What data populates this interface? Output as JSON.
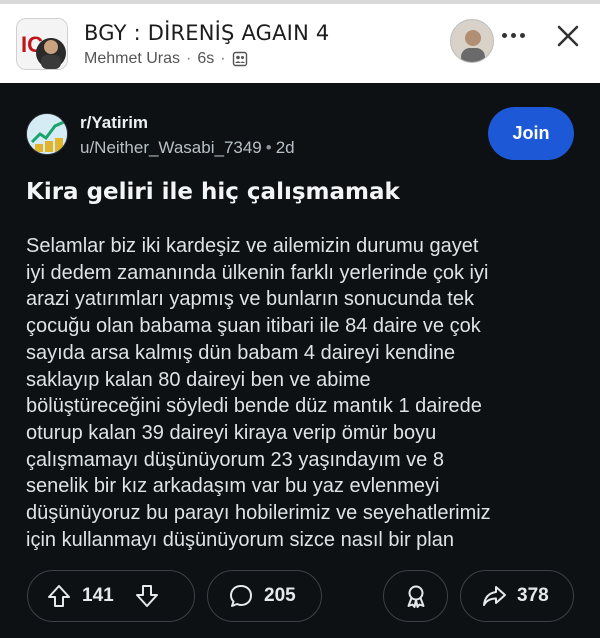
{
  "header": {
    "channel_title": "BGY : DİRENİŞ AGAIN 4",
    "author": "Mehmet Uras",
    "separator": "·",
    "time_ago": "6s",
    "close_icon": "close-icon",
    "more_icon": "more-dots-icon",
    "visibility_icon": "people-icon"
  },
  "post": {
    "subreddit": "r/Yatirim",
    "username": "u/Neither_Wasabi_7349",
    "separator": "•",
    "time_ago": "2d",
    "join_label": "Join",
    "join_color": "#1d59d6",
    "title": "Kira geliri ile hiç çalışmamak",
    "body_lines": [
      "Selamlar biz iki kardeşiz ve ailemizin durumu gayet",
      "iyi dedem zamanında ülkenin farklı yerlerinde çok iyi",
      "arazi yatırımları yapmış ve bunların sonucunda tek",
      "çocuğu olan babama şuan itibari ile 84 daire ve çok",
      "sayıda arsa kalmış dün babam 4 daireyi kendine",
      "saklayıp kalan 80 daireyi ben ve abime",
      "bölüştüreceğini söyledi bende düz mantık 1 dairede",
      "oturup kalan 39 daireyi kiraya verip ömür boyu",
      "çalışmamayı düşünüyorum 23 yaşındayım ve 8",
      "senelik bir kız arkadaşım var bu yaz evlenmeyi",
      "düşünüyoruz bu parayı hobilerimiz ve seyehatlerimiz",
      "için kullanmayı düşünüyorum sizce nasıl bir plan"
    ]
  },
  "actions": {
    "upvotes": "141",
    "comments": "205",
    "shares": "378",
    "upvote_icon": "upvote-arrow-icon",
    "downvote_icon": "downvote-arrow-icon",
    "comment_icon": "comment-bubble-icon",
    "award_icon": "award-icon",
    "share_icon": "share-arrow-icon"
  },
  "colors": {
    "post_background": "#0e1113",
    "header_background": "#ffffff"
  }
}
